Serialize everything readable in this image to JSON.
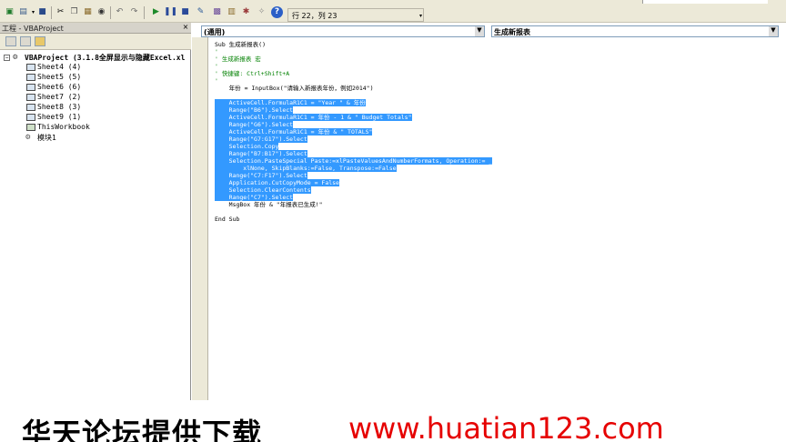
{
  "toolbar": {
    "position": "行 22，列 23",
    "icons": [
      "excel-icon",
      "insert-icon",
      "save-icon",
      "cut-icon",
      "copy-icon",
      "paste-icon",
      "find-icon",
      "undo-icon",
      "redo-icon",
      "run-icon",
      "break-icon",
      "reset-icon",
      "design-icon",
      "project-explorer-icon",
      "properties-icon",
      "object-browser-icon",
      "toolbox-icon",
      "help-icon"
    ]
  },
  "project": {
    "title": "工程 - VBAProject",
    "close": "×",
    "tree": {
      "root": "VBAProject (3.1.8全屏显示与隐藏Excel.xl",
      "items": [
        "Sheet4 (4)",
        "Sheet5 (5)",
        "Sheet6 (6)",
        "Sheet7 (2)",
        "Sheet8 (3)",
        "Sheet9 (1)",
        "ThisWorkbook",
        "模块1"
      ]
    }
  },
  "code": {
    "object_combo": "(通用)",
    "procedure_combo": "生成新报表",
    "lines": [
      {
        "text": "Sub 生成新报表()",
        "style": ""
      },
      {
        "text": "'",
        "style": "comment"
      },
      {
        "text": "' 生成新报表 宏",
        "style": "comment"
      },
      {
        "text": "'",
        "style": "comment"
      },
      {
        "text": "' 快捷键: Ctrl+Shift+A",
        "style": "comment"
      },
      {
        "text": "'",
        "style": "comment"
      },
      {
        "text": "    年份 = InputBox(\"请输入新报表年份，例如2014\")",
        "style": ""
      },
      {
        "text": "",
        "style": ""
      },
      {
        "text": "    ActiveCell.FormulaR1C1 = \"Year \" & 年份",
        "style": "selected"
      },
      {
        "text": "    Range(\"B6\").Select",
        "style": "selected"
      },
      {
        "text": "    ActiveCell.FormulaR1C1 = 年份 - 1 & \" Budget Totals\"",
        "style": "selected"
      },
      {
        "text": "    Range(\"G6\").Select",
        "style": "selected"
      },
      {
        "text": "    ActiveCell.FormulaR1C1 = 年份 & \" TOTALS\"",
        "style": "selected"
      },
      {
        "text": "    Range(\"G7:G17\").Select",
        "style": "selected"
      },
      {
        "text": "    Selection.Copy",
        "style": "selected"
      },
      {
        "text": "    Range(\"B7:B17\").Select",
        "style": "selected"
      },
      {
        "text": "    Selection.PasteSpecial Paste:=xlPasteValuesAndNumberFormats, Operation:= _",
        "style": "selected"
      },
      {
        "text": "        xlNone, SkipBlanks:=False, Transpose:=False",
        "style": "selected"
      },
      {
        "text": "    Range(\"C7:F17\").Select",
        "style": "selected"
      },
      {
        "text": "    Application.CutCopyMode = False",
        "style": "selected"
      },
      {
        "text": "    Selection.ClearContents",
        "style": "selected"
      },
      {
        "text": "    Range(\"C7\").Select",
        "style": "selected"
      },
      {
        "text": "    MsgBox 年份 & \"年报表已生成!\"",
        "style": ""
      },
      {
        "text": "",
        "style": ""
      },
      {
        "text": "End Sub",
        "style": ""
      }
    ]
  },
  "banner": {
    "cn": "华天论坛提供下载",
    "url": "www.huatian123.com"
  },
  "colors": {
    "selection": "#3399ff",
    "comment": "#008000",
    "url": "#e60000",
    "chrome": "#ece9d8"
  }
}
